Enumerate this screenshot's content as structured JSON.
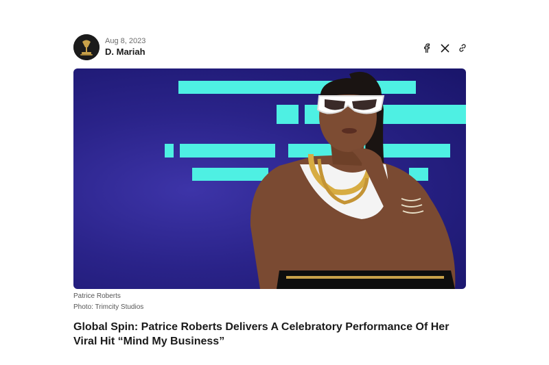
{
  "byline": {
    "date": "Aug 8, 2023",
    "author": "D. Mariah",
    "avatar_icon": "grammy-gramophone-icon"
  },
  "share": {
    "icons": [
      "facebook-icon",
      "x-icon",
      "link-icon"
    ]
  },
  "hero": {
    "background_color": "#2a2389",
    "accent_color": "#4ef0e3",
    "alt": "Patrice Roberts"
  },
  "caption": {
    "subject": "Patrice Roberts",
    "credit": "Photo: Trimcity Studios"
  },
  "article": {
    "title": "Global Spin: Patrice Roberts Delivers A Celebratory Performance Of Her Viral Hit “Mind My Business”"
  }
}
